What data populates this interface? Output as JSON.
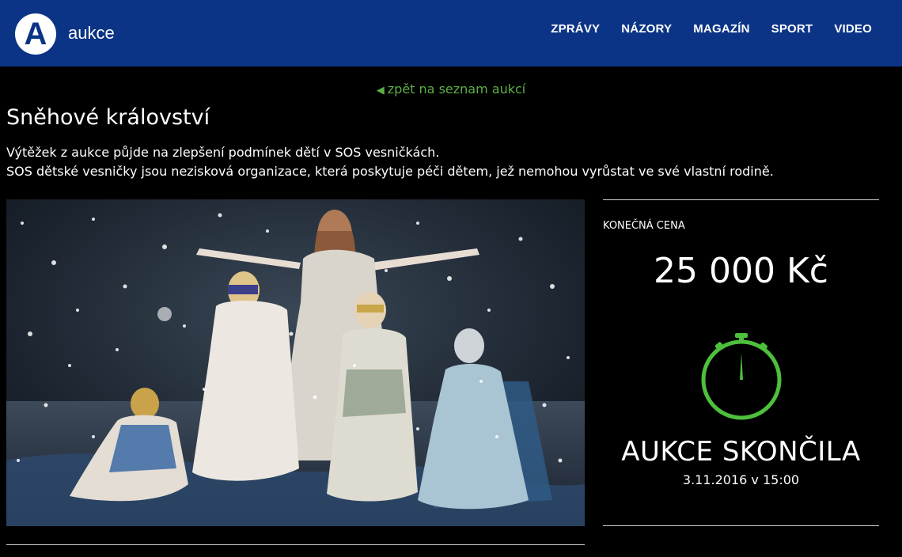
{
  "header": {
    "logo_letter": "A",
    "brand": "aukce",
    "nav": [
      "ZPRÁVY",
      "NÁZORY",
      "MAGAZÍN",
      "SPORT",
      "VIDEO"
    ]
  },
  "back_link": {
    "arrow": "◀",
    "label": "zpět na seznam aukcí"
  },
  "auction": {
    "title": "Sněhové království",
    "description_line1": "Výtěžek z aukce půjde na zlepšení podmínek dětí v SOS vesničkách.",
    "description_line2": "SOS dětské vesničky jsou nezisková organizace, která poskytuje péči dětem, jež nemohou vyrůstat ve své vlastní rodině.",
    "photo_icon": "snow-queen-photo"
  },
  "sidebar": {
    "price_label": "KONEČNÁ CENA",
    "price": "25 000 Kč",
    "timer_icon": "stopwatch-icon",
    "status": "AUKCE SKONČILA",
    "ended_at": "3.11.2016 v 15:00"
  },
  "colors": {
    "header_bg": "#0b3486",
    "accent_green": "#5cb046",
    "stopwatch_green": "#4dc03c",
    "page_bg": "#000000"
  }
}
